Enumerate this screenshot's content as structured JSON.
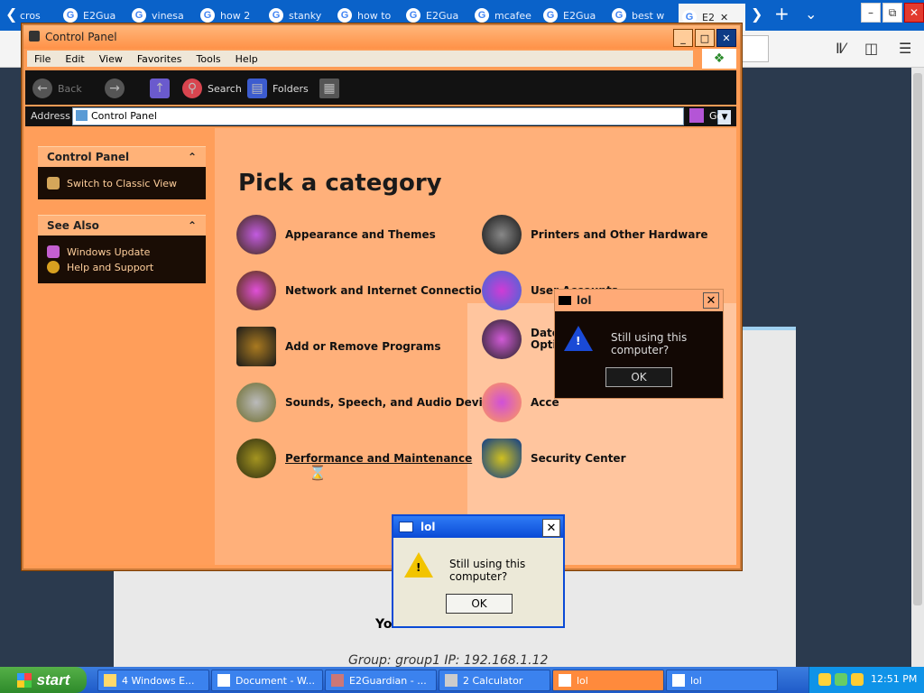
{
  "browser": {
    "tabs": [
      {
        "label": "cros",
        "favicon": "windows-icon"
      },
      {
        "label": "E2Gua",
        "favicon": "google-icon"
      },
      {
        "label": "vinesa",
        "favicon": "google-icon"
      },
      {
        "label": "how 2",
        "favicon": "google-icon"
      },
      {
        "label": "stanky",
        "favicon": "google-icon"
      },
      {
        "label": "how to",
        "favicon": "google-icon"
      },
      {
        "label": "E2Gua",
        "favicon": "google-icon"
      },
      {
        "label": "mcafee",
        "favicon": "google-icon"
      },
      {
        "label": "E2Gua",
        "favicon": "google-icon"
      },
      {
        "label": "best w",
        "favicon": "google-icon"
      },
      {
        "label": "E2",
        "favicon": "google-icon",
        "active": true
      }
    ],
    "page": {
      "text_you": "Yo",
      "group_line": "Group: group1   IP: 192.168.1.12"
    }
  },
  "window": {
    "title": "Control Panel",
    "menu": [
      "File",
      "Edit",
      "View",
      "Favorites",
      "Tools",
      "Help"
    ],
    "toolbar": {
      "back": "Back",
      "search": "Search",
      "folders": "Folders"
    },
    "address": {
      "label": "Address",
      "value": "Control Panel",
      "go": "Go"
    },
    "left": {
      "control_panel": {
        "header": "Control Panel",
        "items": [
          "Switch to Classic View"
        ]
      },
      "see_also": {
        "header": "See Also",
        "items": [
          "Windows Update",
          "Help and Support"
        ]
      }
    },
    "heading": "Pick a category",
    "categories": [
      "Appearance and Themes",
      "Printers and Other Hardware",
      "Network and Internet Connections",
      "User Accounts",
      "Add or Remove Programs",
      "Date",
      "Optio",
      "Sounds, Speech, and Audio Devices",
      "Acce",
      "Performance and Maintenance",
      "Security Center"
    ]
  },
  "dialog_dark": {
    "title": "lol",
    "message": "Still using this computer?",
    "ok": "OK"
  },
  "dialog_light": {
    "title": "lol",
    "message": "Still using this computer?",
    "ok": "OK"
  },
  "taskbar": {
    "start": "start",
    "tasks": [
      "4 Windows E...",
      "Document - W...",
      "E2Guardian - ...",
      "2 Calculator",
      "lol",
      "lol"
    ],
    "clock": "12:51 PM"
  }
}
